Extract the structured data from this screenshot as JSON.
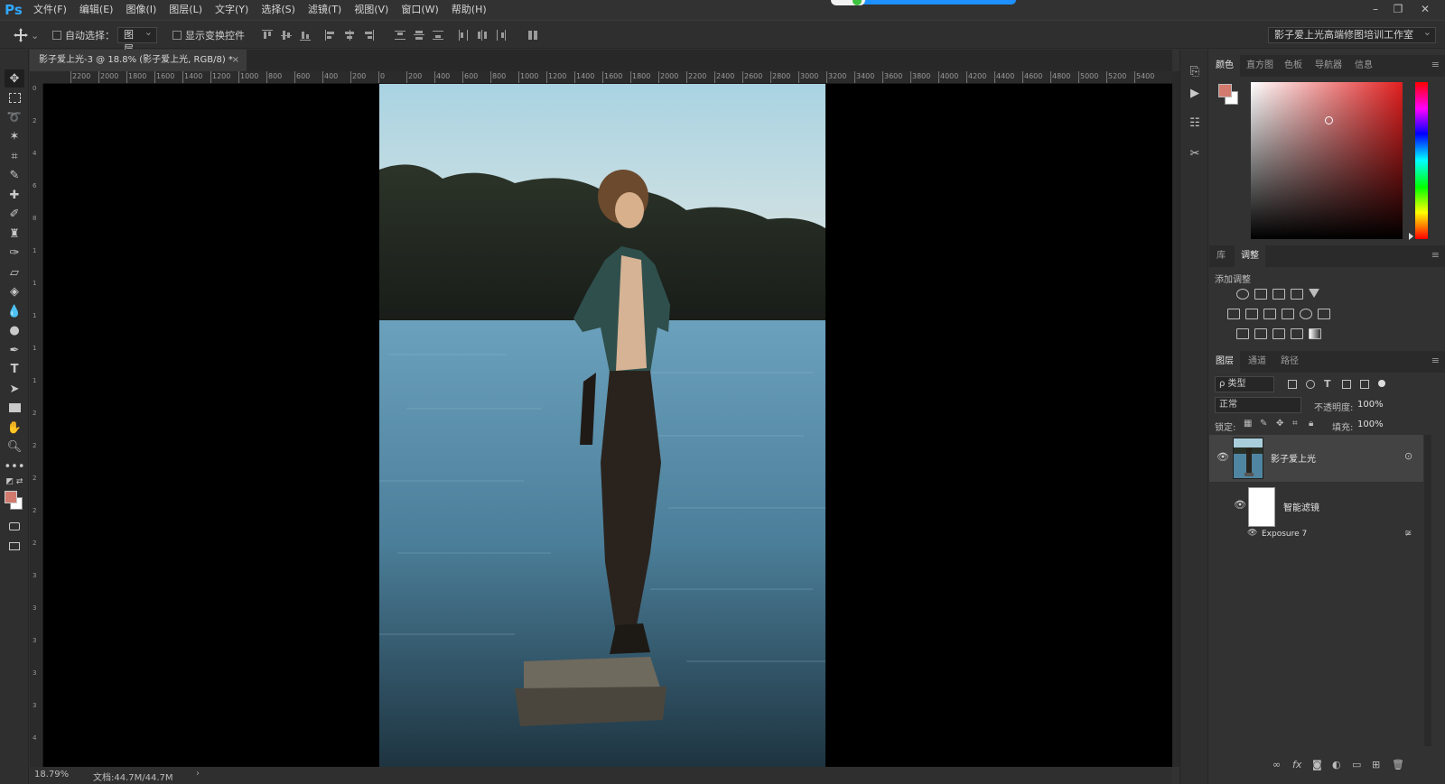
{
  "app": {
    "logo": "Ps"
  },
  "menu": [
    "文件(F)",
    "编辑(E)",
    "图像(I)",
    "图层(L)",
    "文字(Y)",
    "选择(S)",
    "滤镜(T)",
    "视图(V)",
    "窗口(W)",
    "帮助(H)"
  ],
  "window_controls": [
    "–",
    "❐",
    "✕"
  ],
  "options_bar": {
    "auto_select_label": "自动选择：",
    "auto_select_value": "图层",
    "show_transform_label": "显示变换控件",
    "workspace": "影子爱上光高端修图培训工作室"
  },
  "document": {
    "tab_title": "影子爱上光-3 @ 18.8% (影子爱上光, RGB/8) *",
    "close": "×",
    "zoom": "18.79%",
    "doc_size": "文档:44.7M/44.7M",
    "status_arrow": "›"
  },
  "ruler": {
    "top_labels": [
      "2200",
      "2000",
      "1800",
      "1600",
      "1400",
      "1200",
      "1000",
      "800",
      "600",
      "400",
      "200",
      "0",
      "200",
      "400",
      "600",
      "800",
      "1000",
      "1200",
      "1400",
      "1600",
      "1800",
      "2000",
      "2200",
      "2400",
      "2600",
      "2800",
      "3000",
      "3200",
      "3400",
      "3600",
      "3800",
      "4000",
      "4200",
      "4400",
      "4600",
      "4800",
      "5000",
      "5200",
      "5400"
    ],
    "left_labels": [
      "0",
      "2",
      "4",
      "6",
      "8",
      "1",
      "1",
      "1",
      "1",
      "1",
      "2",
      "2",
      "2",
      "2",
      "2",
      "3",
      "3",
      "3",
      "3",
      "3",
      "4"
    ]
  },
  "colors": {
    "foreground": "#d27a6e",
    "background": "#ffffff",
    "accent": "#31a8ff"
  },
  "color_panel": {
    "tabs": [
      "颜色",
      "直方图",
      "色板",
      "导航器",
      "信息"
    ],
    "menu_icon": "≡"
  },
  "adjust_panel": {
    "tabs": [
      "库",
      "调整"
    ],
    "add_label": "添加调整"
  },
  "layers_panel": {
    "tabs": [
      "图层",
      "通道",
      "路径"
    ],
    "filter_label": "ρ 类型",
    "blend_mode": "正常",
    "opacity_label": "不透明度:",
    "opacity_value": "100%",
    "lock_label": "锁定:",
    "fill_label": "填充:",
    "fill_value": "100%",
    "layers": [
      {
        "name": "影子爱上光",
        "type": "smart-object"
      },
      {
        "name": "智能滤镜",
        "type": "smart-filter-mask"
      },
      {
        "name": "Exposure 7",
        "type": "filter"
      }
    ]
  }
}
